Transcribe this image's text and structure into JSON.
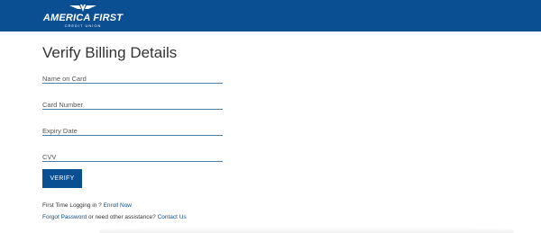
{
  "colors": {
    "brand": "#0b4f93",
    "background": "#f3f5f8"
  },
  "header": {
    "logo_name": "AMERICA FIRST",
    "logo_sub": "CREDIT UNION",
    "logo_icon": "wing-emblem-icon"
  },
  "form": {
    "title": "Verify Billing Details",
    "name_placeholder": "Name on Card",
    "card_placeholder": "Card Number",
    "expiry_placeholder": "Expiry Date",
    "cvv_placeholder": "CVV",
    "verify_label": "VERIFY"
  },
  "footer_links": {
    "first_time_text": "First Time Logging in ?",
    "enroll_label": "Enroll Now",
    "forgot_label": "Forgot Password",
    "assistance_text": "or need other assistance?",
    "contact_label": "Contact Us"
  }
}
